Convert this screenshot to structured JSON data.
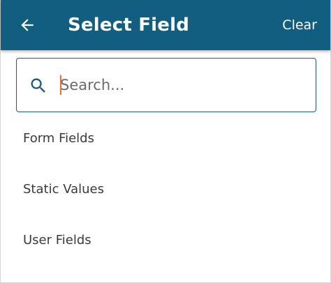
{
  "header": {
    "title": "Select Field",
    "back_icon": "arrow-left-icon",
    "clear_label": "Clear",
    "background_color": "#125e80",
    "text_color": "#ffffff"
  },
  "search": {
    "placeholder": "Search...",
    "value": "",
    "icon": "search-icon",
    "border_color": "#1b5d7a",
    "caret_color": "#f26c2b"
  },
  "field_list": {
    "items": [
      {
        "label": "Form Fields"
      },
      {
        "label": "Static Values"
      },
      {
        "label": "User Fields"
      }
    ]
  }
}
